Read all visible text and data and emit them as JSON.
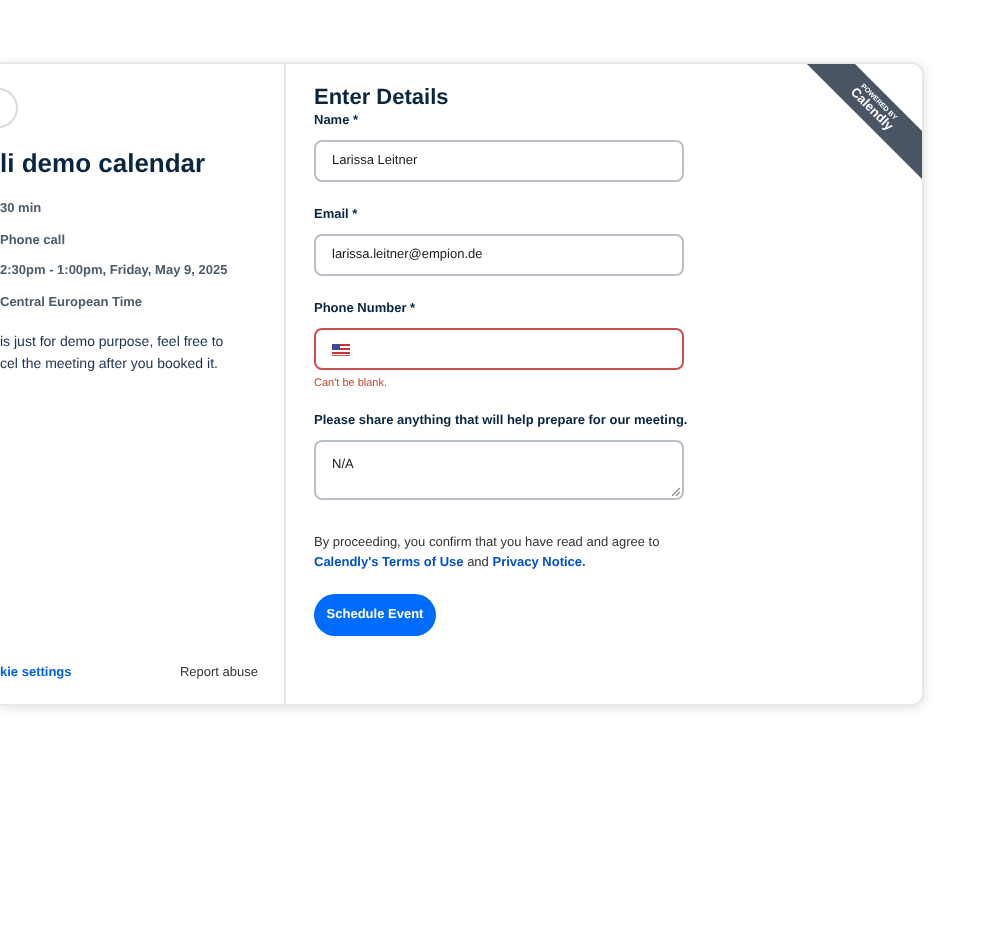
{
  "event": {
    "title": "li demo calendar",
    "details": [
      "30 min",
      "Phone call",
      "2:30pm - 1:00pm, Friday, May 9, 2025",
      "Central European Time"
    ],
    "description_lines": [
      "is just for demo purpose, feel free to",
      "cel the meeting after you booked it."
    ],
    "footer": {
      "settings_link": "kie settings",
      "report_link": "Report abuse"
    }
  },
  "form": {
    "title": "Enter Details",
    "fields": [
      {
        "kind": "input",
        "label": "Name *",
        "value": "Larissa Leitner",
        "invalid": false
      },
      {
        "kind": "input",
        "label": "Email *",
        "value": "larissa.leitner@empion.de",
        "invalid": false
      },
      {
        "kind": "phone",
        "label": "Phone Number *",
        "invalid": true,
        "error": "Can't be blank."
      },
      {
        "kind": "textarea",
        "label": "Please share anything that will help prepare for our meeting.",
        "value": "N/A",
        "invalid": false
      }
    ],
    "consent": {
      "text": "By proceeding, you confirm that you have read and agree to",
      "terms_link": "Calendly's Terms of Use",
      "joiner": "and",
      "privacy_link": "Privacy Notice."
    },
    "submit": "Schedule Event"
  },
  "ribbon": {
    "caption": "POWERED BY",
    "brand": "Calendly"
  }
}
